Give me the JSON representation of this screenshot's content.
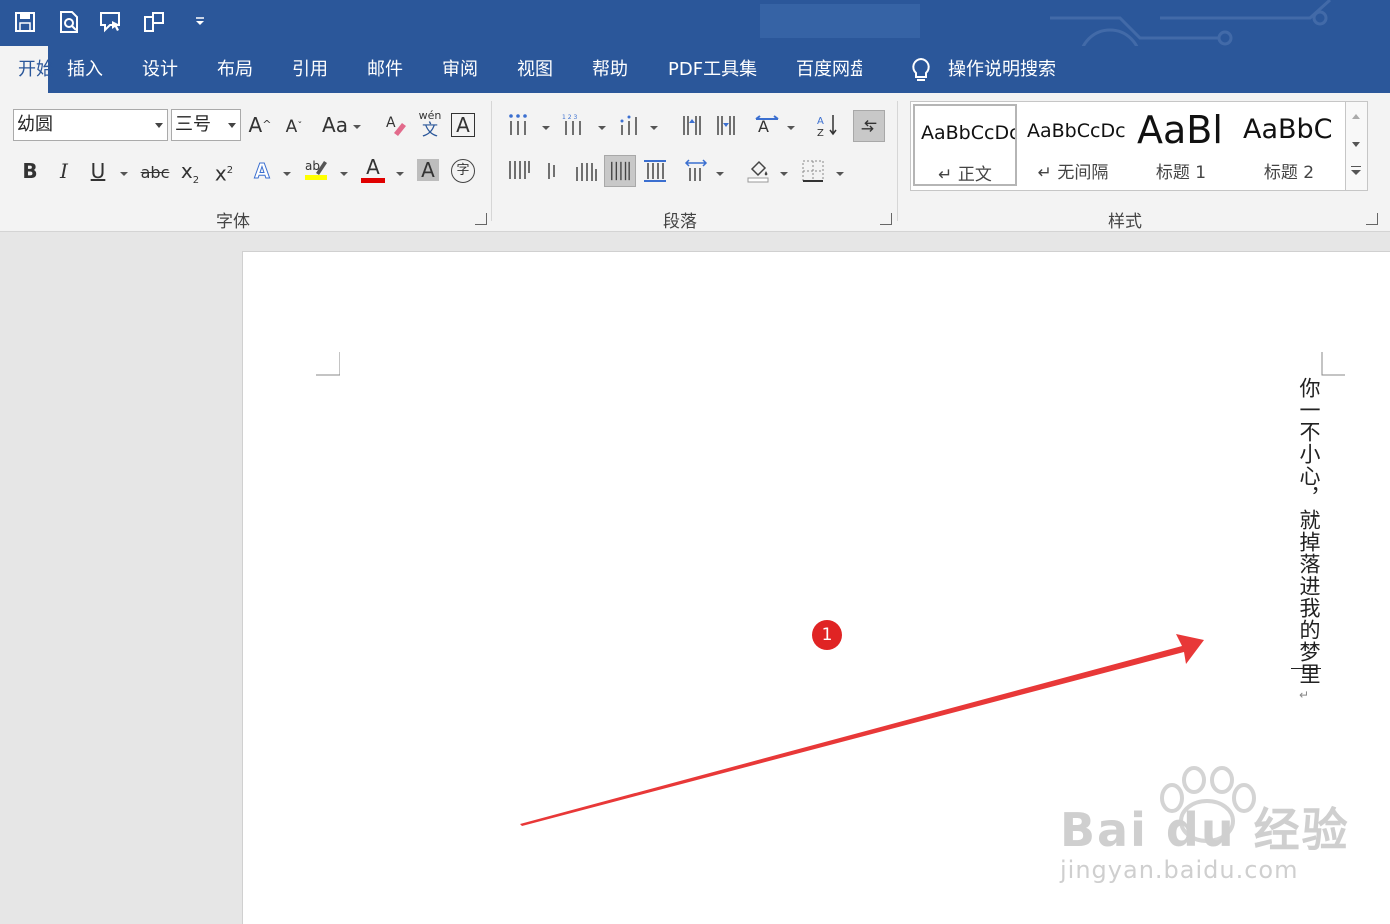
{
  "tabs": [
    {
      "label": "开始",
      "active": true
    },
    {
      "label": "插入"
    },
    {
      "label": "设计"
    },
    {
      "label": "布局"
    },
    {
      "label": "引用"
    },
    {
      "label": "邮件"
    },
    {
      "label": "审阅"
    },
    {
      "label": "视图"
    },
    {
      "label": "帮助"
    },
    {
      "label": "PDF工具集"
    },
    {
      "label": "百度网盘"
    }
  ],
  "tell_me": "操作说明搜索",
  "font": {
    "name": "幼圆",
    "size": "三号",
    "group_label": "字体",
    "phonetic_top": "wén",
    "phonetic_bottom": "文"
  },
  "paragraph": {
    "group_label": "段落"
  },
  "styles": {
    "group_label": "样式",
    "items": [
      {
        "preview": "AaBbCcDc",
        "name": "↵ 正文"
      },
      {
        "preview": "AaBbCcDc",
        "name": "↵ 无间隔"
      },
      {
        "preview": "AaBl",
        "name": "标题 1"
      },
      {
        "preview": "AaBbC",
        "name": "标题 2"
      }
    ]
  },
  "document": {
    "vertical_text": "你一不小心，就掉落进我的梦里"
  },
  "annotation": {
    "step": "1"
  },
  "watermark": {
    "brand": "Bai du 经验",
    "url": "jingyan.baidu.com"
  },
  "colors": {
    "ribbon_blue": "#2b579a",
    "highlight": "#ffff00",
    "font_color": "#e00000",
    "arrow": "#e83838"
  }
}
